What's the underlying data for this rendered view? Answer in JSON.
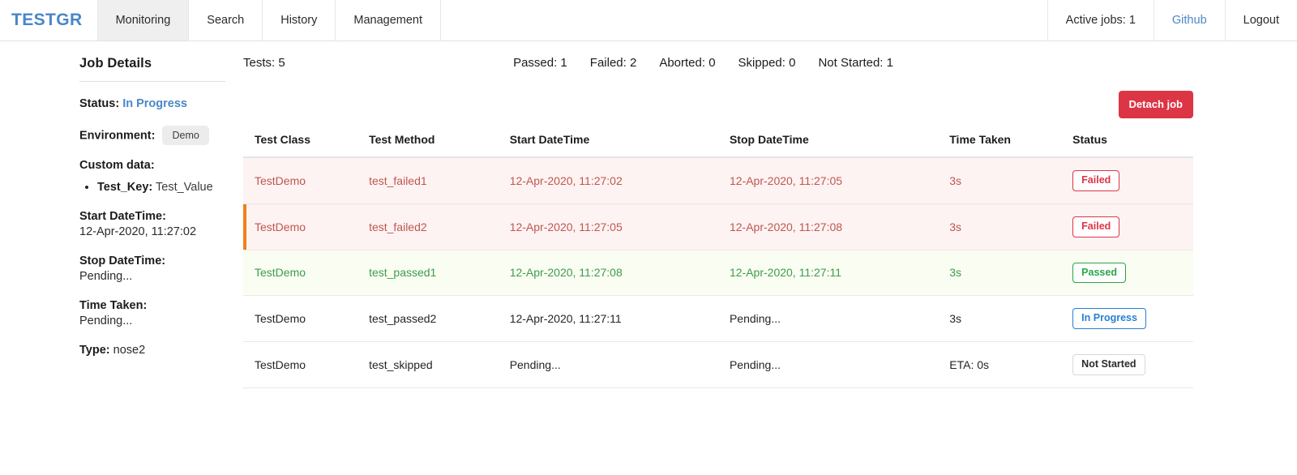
{
  "navbar": {
    "brand": "TESTGR",
    "items": [
      {
        "label": "Monitoring",
        "active": true
      },
      {
        "label": "Search",
        "active": false
      },
      {
        "label": "History",
        "active": false
      },
      {
        "label": "Management",
        "active": false
      }
    ],
    "active_jobs": "Active jobs: 1",
    "github": "Github",
    "logout": "Logout"
  },
  "sidebar": {
    "title": "Job Details",
    "status_label": "Status:",
    "status_value": "In Progress",
    "environment_label": "Environment:",
    "environment_value": "Demo",
    "custom_data_label": "Custom data:",
    "custom_data": [
      {
        "key": "Test_Key:",
        "value": "Test_Value"
      }
    ],
    "start_label": "Start DateTime:",
    "start_value": "12-Apr-2020, 11:27:02",
    "stop_label": "Stop DateTime:",
    "stop_value": "Pending...",
    "time_taken_label": "Time Taken:",
    "time_taken_value": "Pending...",
    "type_label": "Type:",
    "type_value": "nose2"
  },
  "main": {
    "tests_total": "Tests: 5",
    "stats": [
      "Passed: 1",
      "Failed: 2",
      "Aborted: 0",
      "Skipped: 0",
      "Not Started: 1"
    ],
    "detach_button": "Detach job",
    "columns": [
      "Test Class",
      "Test Method",
      "Start DateTime",
      "Stop DateTime",
      "Time Taken",
      "Status"
    ],
    "rows": [
      {
        "test_class": "TestDemo",
        "test_method": "test_failed1",
        "start": "12-Apr-2020, 11:27:02",
        "stop": "12-Apr-2020, 11:27:05",
        "time_taken": "3s",
        "status": "Failed",
        "row_style": "row-failed",
        "badge_style": "badge-failed",
        "marked": false
      },
      {
        "test_class": "TestDemo",
        "test_method": "test_failed2",
        "start": "12-Apr-2020, 11:27:05",
        "stop": "12-Apr-2020, 11:27:08",
        "time_taken": "3s",
        "status": "Failed",
        "row_style": "row-failed",
        "badge_style": "badge-failed",
        "marked": true
      },
      {
        "test_class": "TestDemo",
        "test_method": "test_passed1",
        "start": "12-Apr-2020, 11:27:08",
        "stop": "12-Apr-2020, 11:27:11",
        "time_taken": "3s",
        "status": "Passed",
        "row_style": "row-passed",
        "badge_style": "badge-passed",
        "marked": false
      },
      {
        "test_class": "TestDemo",
        "test_method": "test_passed2",
        "start": "12-Apr-2020, 11:27:11",
        "stop": "Pending...",
        "time_taken": "3s",
        "status": "In Progress",
        "row_style": "row-plain",
        "badge_style": "badge-inprogress",
        "marked": false
      },
      {
        "test_class": "TestDemo",
        "test_method": "test_skipped",
        "start": "Pending...",
        "stop": "Pending...",
        "time_taken": "ETA: 0s",
        "status": "Not Started",
        "row_style": "row-plain",
        "badge_style": "badge-notstarted",
        "marked": false
      }
    ]
  },
  "colors": {
    "brand": "#4a86c8",
    "failed": "#dc3545",
    "passed": "#28a745",
    "in_progress": "#2a7fd4",
    "marker": "#f0801a"
  }
}
